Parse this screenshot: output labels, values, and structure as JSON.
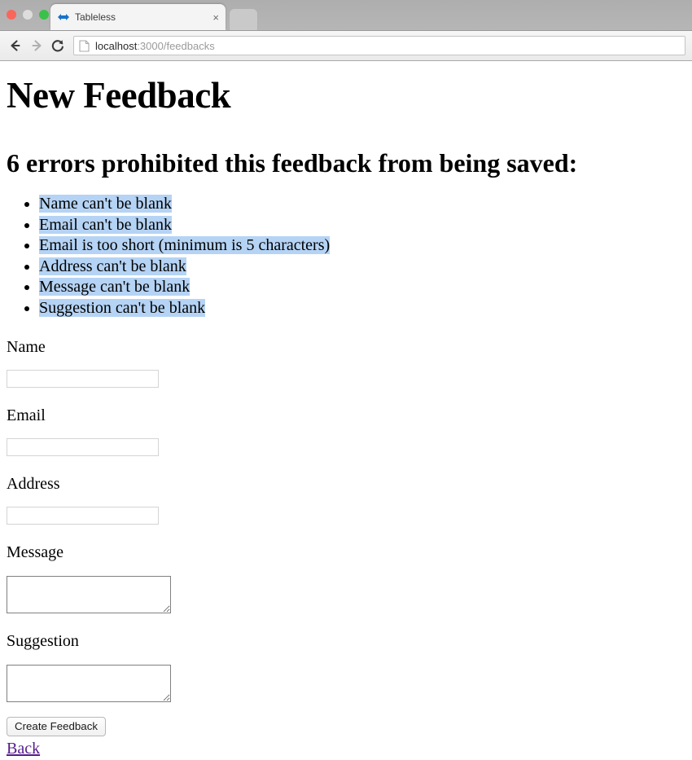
{
  "browser": {
    "window_controls": [
      {
        "name": "close",
        "color": "#f9675c"
      },
      {
        "name": "minimize",
        "color": "#dddddd"
      },
      {
        "name": "zoom",
        "color": "#3bc14a"
      }
    ],
    "tab": {
      "title": "Tableless",
      "favicon": "blue-chevron-diamond-icon",
      "close_label": "×"
    },
    "new_tab_label": "",
    "nav": {
      "back_icon": "arrow-left-icon",
      "forward_icon": "arrow-right-icon",
      "reload_icon": "reload-icon"
    },
    "url": {
      "host": "localhost",
      "path": ":3000/feedbacks",
      "full": "localhost:3000/feedbacks",
      "page_icon": "document-icon"
    }
  },
  "page": {
    "title": "New Feedback",
    "error_heading": "6 errors prohibited this feedback from being saved:",
    "error_count": 6,
    "errors": [
      "Name can't be blank",
      "Email can't be blank",
      "Email is too short (minimum is 5 characters)",
      "Address can't be blank",
      "Message can't be blank",
      "Suggestion can't be blank"
    ],
    "selection_color": "#b5d3f4",
    "form": {
      "fields": [
        {
          "label": "Name",
          "value": "",
          "placeholder": "",
          "type": "input"
        },
        {
          "label": "Email",
          "value": "",
          "placeholder": "",
          "type": "input"
        },
        {
          "label": "Address",
          "value": "",
          "placeholder": "",
          "type": "input"
        },
        {
          "label": "Message",
          "value": "",
          "placeholder": "",
          "type": "textarea"
        },
        {
          "label": "Suggestion",
          "value": "",
          "placeholder": "",
          "type": "textarea"
        }
      ],
      "submit_label": "Create Feedback",
      "back_label": "Back",
      "link_color": "#551a8b"
    }
  }
}
